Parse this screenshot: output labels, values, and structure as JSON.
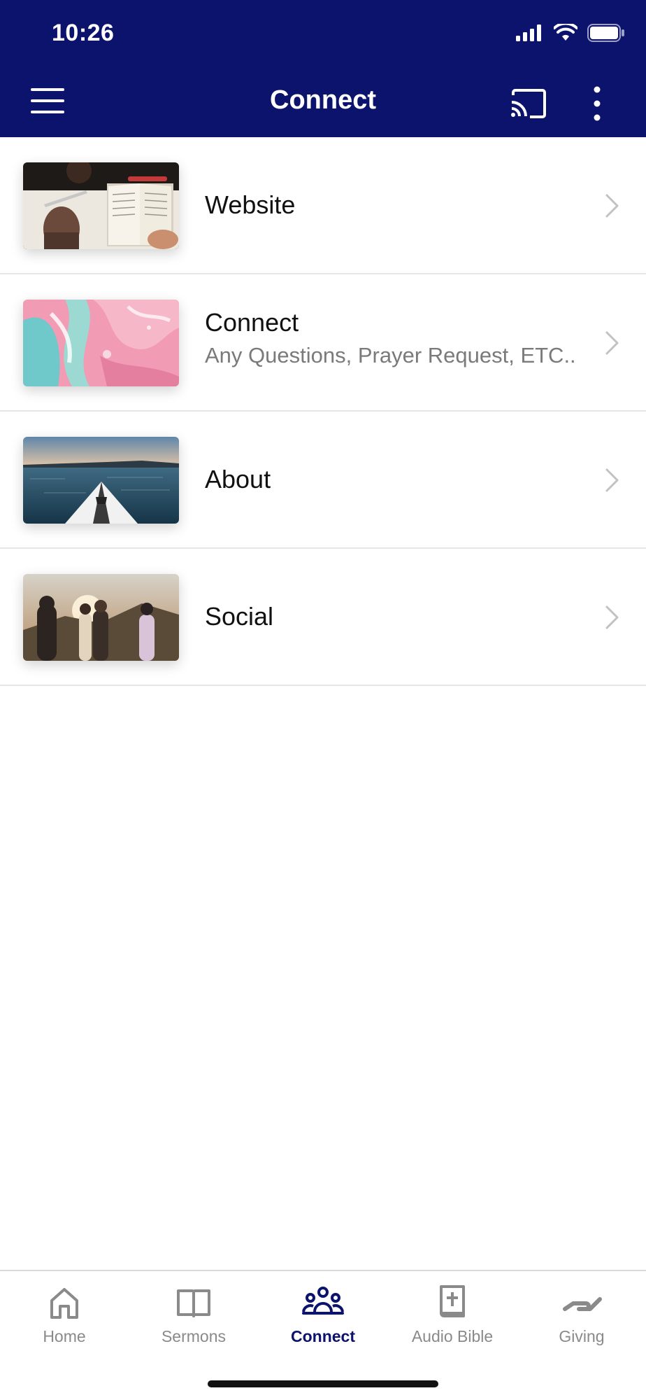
{
  "status_bar": {
    "time": "10:26"
  },
  "app_bar": {
    "title": "Connect"
  },
  "list": [
    {
      "title": "Website",
      "subtitle": ""
    },
    {
      "title": "Connect",
      "subtitle": "Any Questions, Prayer Request, ETC.."
    },
    {
      "title": "About",
      "subtitle": ""
    },
    {
      "title": "Social",
      "subtitle": ""
    }
  ],
  "tabs": [
    {
      "label": "Home",
      "icon": "home-icon"
    },
    {
      "label": "Sermons",
      "icon": "book-icon"
    },
    {
      "label": "Connect",
      "icon": "people-icon"
    },
    {
      "label": "Audio Bible",
      "icon": "bible-icon"
    },
    {
      "label": "Giving",
      "icon": "hand-icon"
    }
  ],
  "active_tab": "Connect",
  "colors": {
    "brand": "#0c136c",
    "inactive": "#8a8a8a"
  }
}
